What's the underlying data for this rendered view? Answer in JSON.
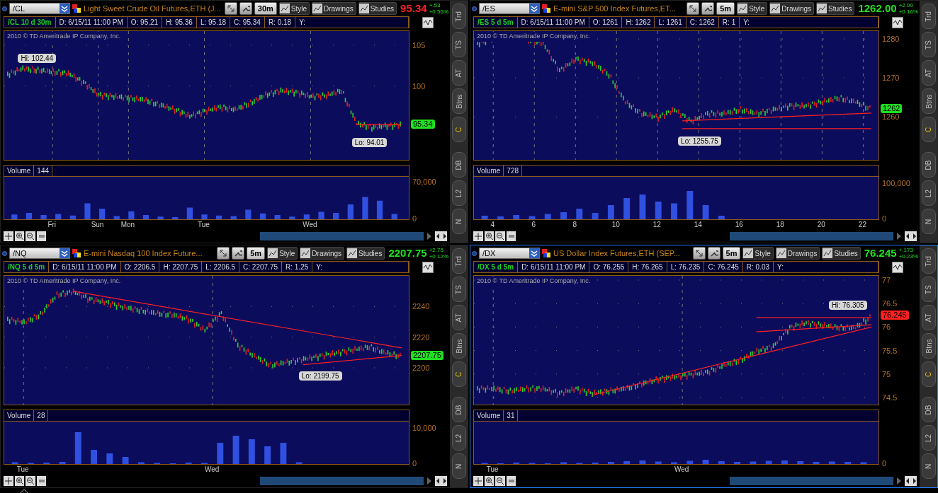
{
  "panels": [
    {
      "selected": false,
      "symbol": "/CL",
      "description": "Light Sweet Crude Oil Futures,ETH (J...",
      "interval": "30m",
      "buttons": [
        "Style",
        "Drawings",
        "Studies"
      ],
      "price": "95.34",
      "falling": true,
      "change": "+.53",
      "change_pct": "+0.56%",
      "info": [
        "/CL 10 d 30m",
        "D: 6/15/11 11:00 PM",
        "O: 95.21",
        "H: 95.36",
        "L: 95.18",
        "C: 95.34",
        "R: 0.18",
        "Y:"
      ],
      "copyright": "2010 © TD Ameritrade IP Company, Inc.",
      "y_axis_labels": [
        "105",
        "100"
      ],
      "x_axis_labels": [
        "Fri",
        "Sun",
        "Mon",
        "Tue",
        "Wed"
      ],
      "markers": [
        {
          "label": "Hi: 102.44",
          "kind": "hi"
        },
        {
          "label": "Lo: 94.01",
          "kind": "lo"
        }
      ],
      "price_tag": {
        "label": "95.34",
        "color": "#20e020"
      },
      "volume": {
        "label": "Volume",
        "value": "144",
        "y_axis_labels": [
          "70,000",
          "0"
        ]
      },
      "tabs": [
        {
          "label": "Trd",
          "selected": false
        },
        {
          "label": "TS",
          "selected": false
        },
        {
          "label": "AT",
          "selected": false
        },
        {
          "label": "Btns",
          "selected": false
        },
        {
          "label": "C",
          "selected": true
        },
        {
          "label": "DB",
          "selected": false
        },
        {
          "label": "L2",
          "selected": false
        },
        {
          "label": "N",
          "selected": false
        }
      ]
    },
    {
      "selected": false,
      "symbol": "/ES",
      "description": "E-mini S&P 500 Index Futures,ET...",
      "interval": "5m",
      "buttons": [
        "Style",
        "Drawings",
        "Studies"
      ],
      "price": "1262.00",
      "falling": false,
      "change": "+2.00",
      "change_pct": "+0.16%",
      "info": [
        "/ES 5 d 5m",
        "D: 6/15/11 11:00 PM",
        "O: 1261",
        "H: 1262",
        "L: 1261",
        "C: 1262",
        "R: 1",
        "Y:"
      ],
      "copyright": "2010 © TD Ameritrade IP Company, Inc.",
      "y_axis_labels": [
        "1280",
        "1270",
        "1260"
      ],
      "x_axis_labels": [
        "4",
        "6",
        "8",
        "10",
        "12",
        "14",
        "16",
        "18",
        "20",
        "22"
      ],
      "markers": [
        {
          "label": "Lo: 1255.75",
          "kind": "lo"
        }
      ],
      "price_tag": {
        "label": "1262",
        "color": "#20e020"
      },
      "volume": {
        "label": "Volume",
        "value": "728",
        "y_axis_labels": [
          "100,000",
          "0"
        ]
      },
      "tabs": [
        {
          "label": "Trd",
          "selected": false
        },
        {
          "label": "TS",
          "selected": false
        },
        {
          "label": "AT",
          "selected": false
        },
        {
          "label": "Btns",
          "selected": false
        },
        {
          "label": "C",
          "selected": true
        },
        {
          "label": "DB",
          "selected": false
        },
        {
          "label": "L2",
          "selected": false
        },
        {
          "label": "N",
          "selected": false
        }
      ]
    },
    {
      "selected": false,
      "symbol": "/NQ",
      "description": "E-mini Nasdaq 100 Index Future...",
      "interval": "5m",
      "buttons": [
        "Style",
        "Drawings",
        "Studies"
      ],
      "price": "2207.75",
      "falling": false,
      "change": "+2.75",
      "change_pct": "+0.12%",
      "info": [
        "/NQ 5 d 5m",
        "D: 6/15/11 11:00 PM",
        "O: 2206.5",
        "H: 2207.75",
        "L: 2206.5",
        "C: 2207.75",
        "R: 1.25",
        "Y:"
      ],
      "copyright": "2010 © TD Ameritrade IP Company, Inc.",
      "y_axis_labels": [
        "2240",
        "2220",
        "2200"
      ],
      "x_axis_labels": [
        "Tue",
        "Wed"
      ],
      "markers": [
        {
          "label": "Lo: 2199.75",
          "kind": "lo"
        }
      ],
      "price_tag": {
        "label": "2207.75",
        "color": "#20e020"
      },
      "volume": {
        "label": "Volume",
        "value": "28",
        "y_axis_labels": [
          "10,000",
          "0"
        ]
      },
      "tabs": [
        {
          "label": "Trd",
          "selected": false
        },
        {
          "label": "TS",
          "selected": false
        },
        {
          "label": "AT",
          "selected": false
        },
        {
          "label": "Btns",
          "selected": false
        },
        {
          "label": "C",
          "selected": true
        },
        {
          "label": "DB",
          "selected": false
        },
        {
          "label": "L2",
          "selected": false
        },
        {
          "label": "N",
          "selected": false
        }
      ]
    },
    {
      "selected": true,
      "symbol": "/DX",
      "description": "US Dollar Index Futures,ETH (SEP...",
      "interval": "5m",
      "buttons": [
        "Style",
        "Drawings",
        "Studies"
      ],
      "price": "76.245",
      "falling": false,
      "change": "+.173",
      "change_pct": "+0.23%",
      "info": [
        "/DX 5 d 5m",
        "D: 6/15/11 11:00 PM",
        "O: 76.255",
        "H: 76.265",
        "L: 76.235",
        "C: 76.245",
        "R: 0.03",
        "Y:"
      ],
      "copyright": "2010 © TD Ameritrade IP Company, Inc.",
      "y_axis_labels": [
        "77",
        "76.5",
        "76",
        "75.5",
        "75",
        "74.5"
      ],
      "x_axis_labels": [
        "Tue",
        "Wed"
      ],
      "markers": [
        {
          "label": "Hi: 76.305",
          "kind": "hi"
        }
      ],
      "price_tag": {
        "label": "76.245",
        "color": "#ff2020"
      },
      "volume": {
        "label": "Volume",
        "value": "31",
        "y_axis_labels": [
          "0"
        ]
      },
      "tabs": [
        {
          "label": "Trd",
          "selected": false
        },
        {
          "label": "TS",
          "selected": false
        },
        {
          "label": "AT",
          "selected": false
        },
        {
          "label": "Btns",
          "selected": false
        },
        {
          "label": "C",
          "selected": true
        },
        {
          "label": "DB",
          "selected": false
        },
        {
          "label": "L2",
          "selected": false
        },
        {
          "label": "N",
          "selected": false
        }
      ]
    }
  ]
}
